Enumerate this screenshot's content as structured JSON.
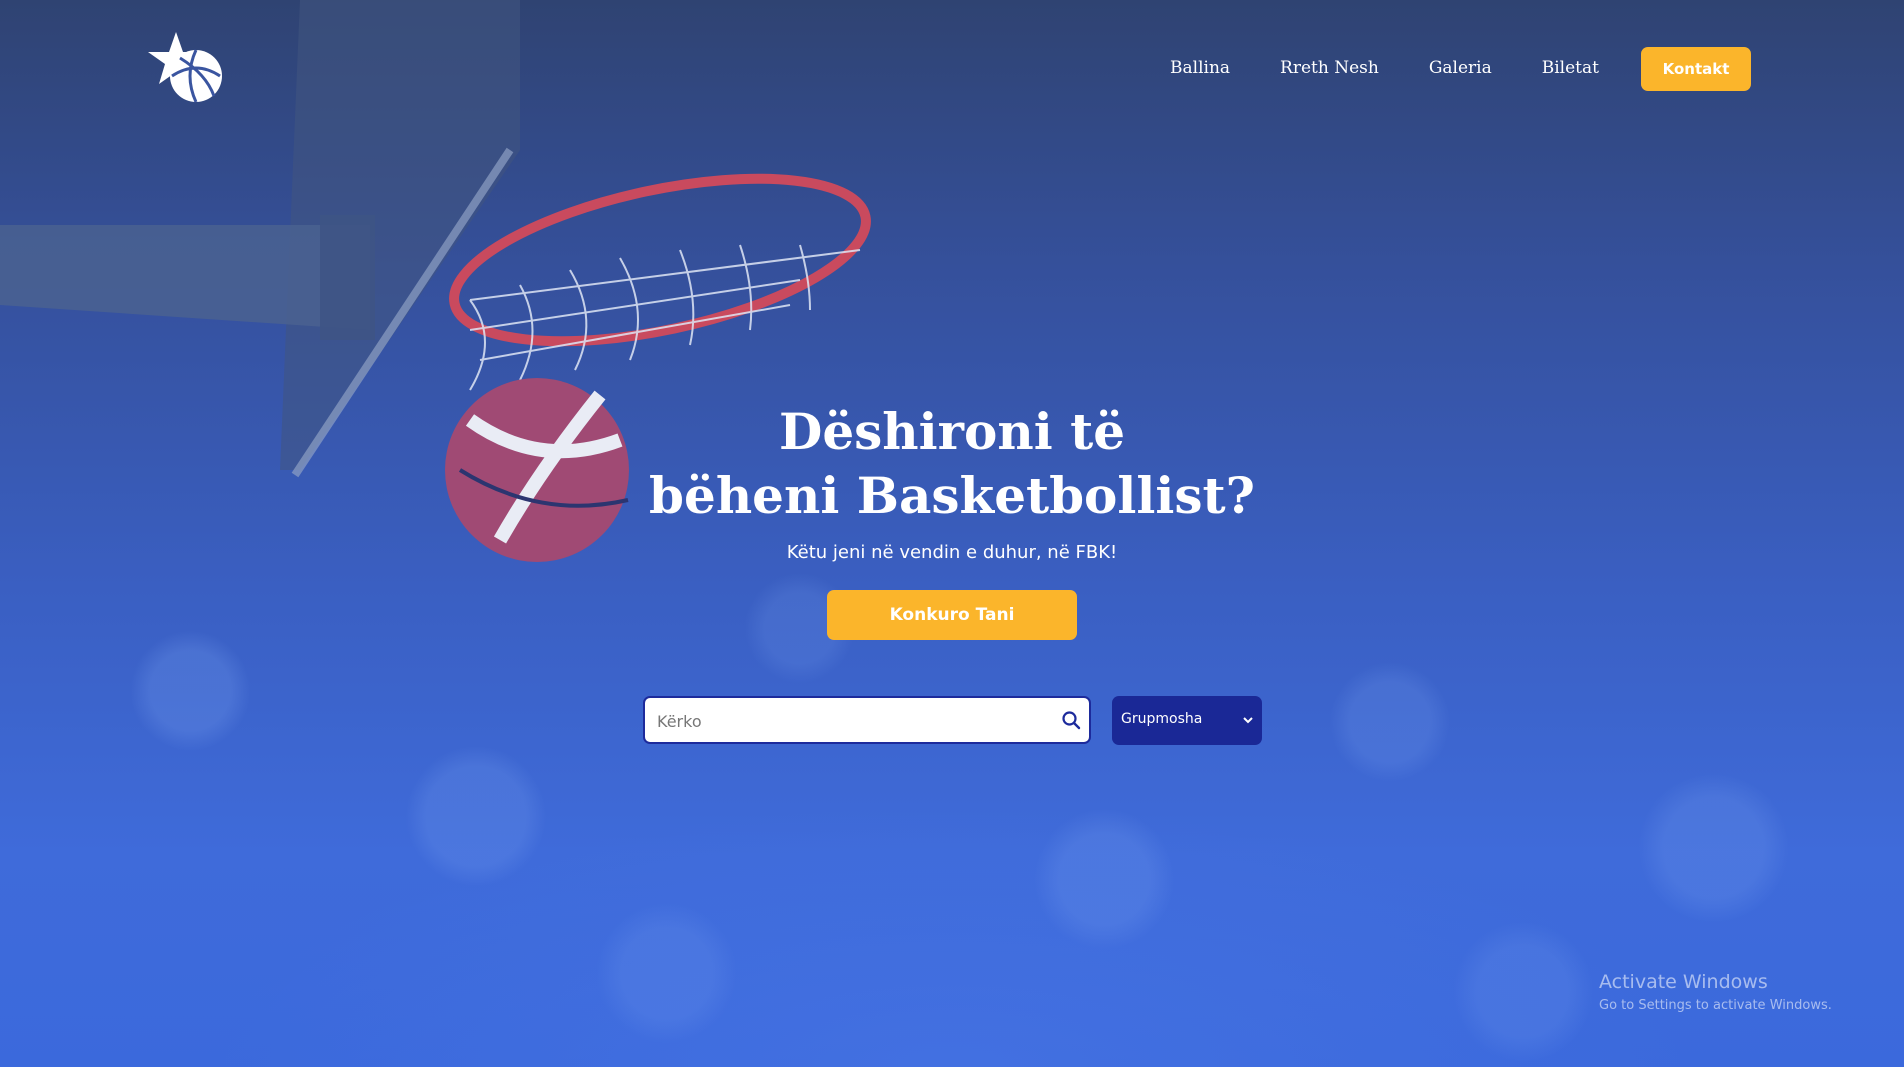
{
  "header": {
    "logo_icon": "basketball-star-logo-icon",
    "nav": [
      {
        "label": "Ballina"
      },
      {
        "label": "Rreth Nesh"
      },
      {
        "label": "Galeria"
      },
      {
        "label": "Biletat"
      }
    ],
    "contact_label": "Kontakt"
  },
  "hero": {
    "title_line1": "Dëshironi të",
    "title_line2": "bëheni Basketbollist?",
    "subtitle": "Këtu jeni në vendin e duhur, në FBK!",
    "cta_label": "Konkuro Tani"
  },
  "search": {
    "placeholder": "Kërko",
    "value": "",
    "icon": "search-icon"
  },
  "filter": {
    "selected": "Grupmosha",
    "icon": "chevron-down-icon"
  },
  "watermark": {
    "title": "Activate Windows",
    "subtitle": "Go to Settings to activate Windows."
  },
  "colors": {
    "accent": "#fbb52b",
    "select_bg": "#1a2896",
    "search_border": "#1d2b9c",
    "bg_top": "#2f4372",
    "bg_bottom": "#3b69dc"
  }
}
